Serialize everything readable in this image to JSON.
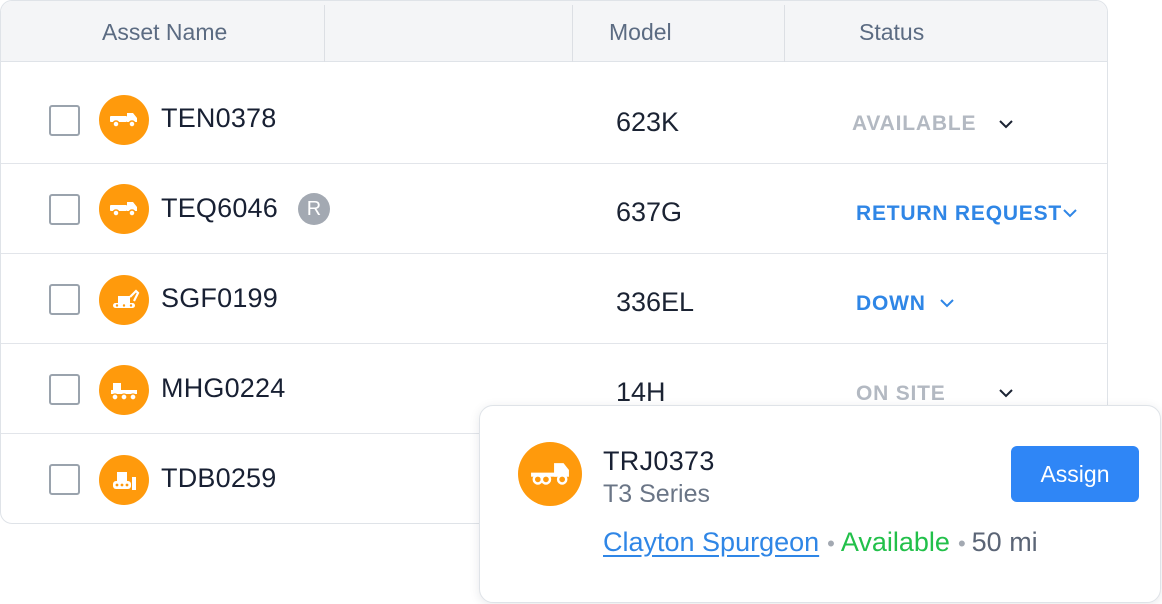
{
  "table": {
    "columns": [
      {
        "key": "asset",
        "label": "Asset Name"
      },
      {
        "key": "model",
        "label": "Model"
      },
      {
        "key": "status",
        "label": "Status"
      }
    ],
    "rows": [
      {
        "name": "TEN0378",
        "icon": "truck-icon",
        "model": "623K",
        "status": "AVAILABLE",
        "status_color": "#b3b9c2"
      },
      {
        "name": "TEQ6046",
        "icon": "truck-icon",
        "badge": "R",
        "model": "637G",
        "status": "RETURN REQUEST",
        "status_color": "#2f86e6"
      },
      {
        "name": "SGF0199",
        "icon": "excavator-icon",
        "model": "336EL",
        "status": "DOWN",
        "status_color": "#2f86e6"
      },
      {
        "name": "MHG0224",
        "icon": "grader-icon",
        "model": "14H",
        "status": "ON SITE",
        "status_color": "#b3b9c2"
      },
      {
        "name": "TDB0259",
        "icon": "bulldozer-icon"
      }
    ]
  },
  "popup": {
    "icon": "truck-icon",
    "title": "TRJ0373",
    "subtitle": "T3 Series",
    "assign_label": "Assign",
    "person": "Clayton Spurgeon",
    "separator": "•",
    "availability": "Available",
    "distance": "50 mi"
  },
  "colors": {
    "accent_orange": "#ff9a0c",
    "primary_blue": "#2f86f6",
    "available_green": "#22c04a",
    "muted_gray": "#b3b9c2"
  }
}
